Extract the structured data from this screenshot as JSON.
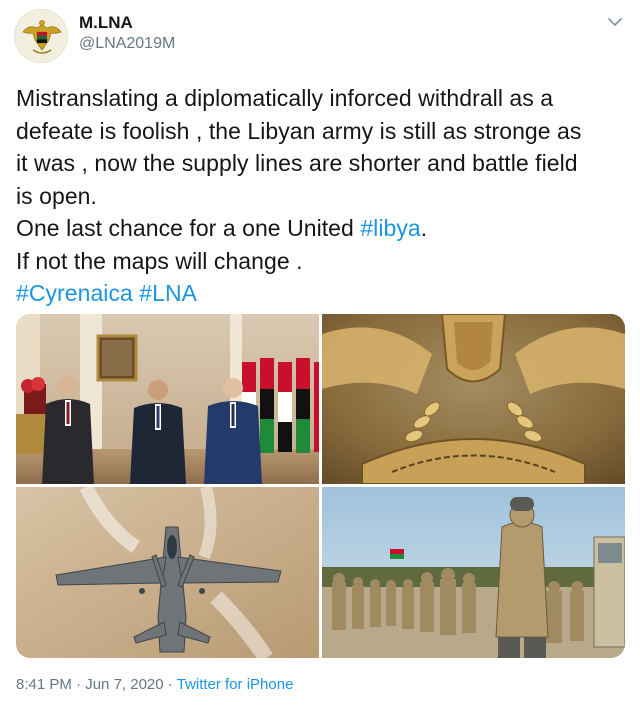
{
  "author": {
    "name": "M.LNA",
    "handle": "@LNA2019M"
  },
  "tweet": {
    "lines": [
      {
        "text": "Mistranslating a diplomatically inforced withdrall as a"
      },
      {
        "text": "defeate is foolish , the Libyan army is still as stronge as"
      },
      {
        "text": "it was , now the supply lines are shorter and battle field"
      },
      {
        "text": "is open."
      },
      {
        "text": "One last chance for a one United ",
        "tag": "#libya",
        "after": "."
      },
      {
        "text": "If not the maps will change ."
      },
      {
        "text": "",
        "tag": "#Cyrenaica",
        "tag2": "#LNA"
      }
    ]
  },
  "media": [
    {
      "name": "leaders-photo",
      "desc": ""
    },
    {
      "name": "emblem-photo",
      "desc": ""
    },
    {
      "name": "jet-photo",
      "desc": ""
    },
    {
      "name": "soldiers-photo",
      "desc": ""
    }
  ],
  "meta": {
    "time": "8:41 PM",
    "separator1": " · ",
    "date": "Jun 7, 2020",
    "separator2": " · ",
    "source": "Twitter for iPhone"
  },
  "icons": {
    "avatar": "eagle-emblem-icon",
    "caret": "chevron-down-icon"
  },
  "colors": {
    "link": "#1b95e0",
    "secondary_text": "#657786",
    "primary_text": "#14171a"
  }
}
